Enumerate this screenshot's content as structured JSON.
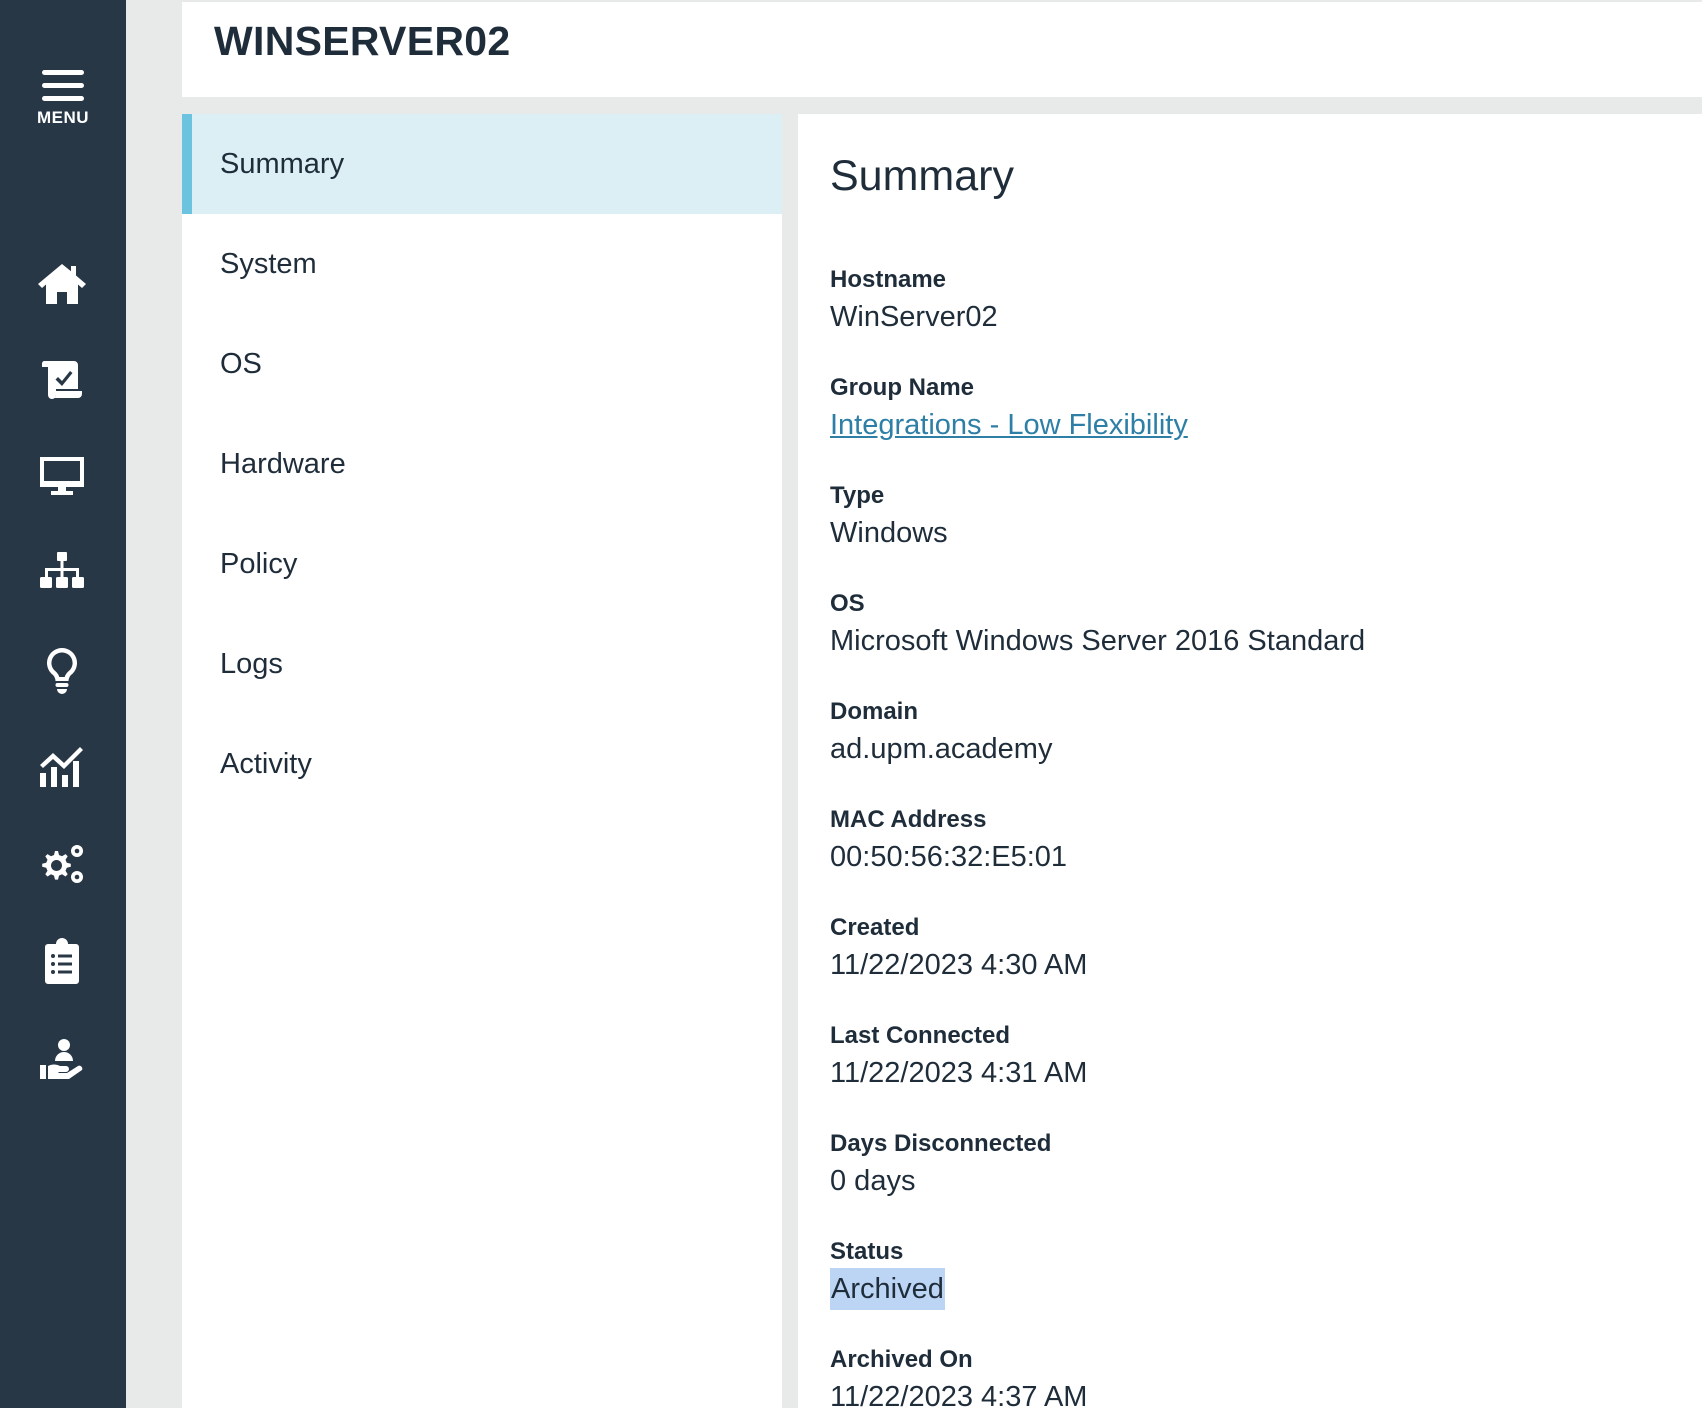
{
  "nav": {
    "menu_label": "MENU",
    "icons": [
      "home-icon",
      "scroll-check-icon",
      "monitor-icon",
      "sitemap-icon",
      "lightbulb-icon",
      "chart-icon",
      "gears-icon",
      "clipboard-list-icon",
      "hand-user-icon"
    ]
  },
  "header": {
    "title": "WINSERVER02"
  },
  "tabs": [
    {
      "label": "Summary",
      "active": true
    },
    {
      "label": "System"
    },
    {
      "label": "OS"
    },
    {
      "label": "Hardware"
    },
    {
      "label": "Policy"
    },
    {
      "label": "Logs"
    },
    {
      "label": "Activity"
    }
  ],
  "summary": {
    "title": "Summary",
    "fields": [
      {
        "label": "Hostname",
        "value": "WinServer02"
      },
      {
        "label": "Group Name",
        "value": "Integrations - Low Flexibility"
      },
      {
        "label": "Type",
        "value": "Windows"
      },
      {
        "label": "OS",
        "value": "Microsoft Windows Server 2016 Standard"
      },
      {
        "label": "Domain",
        "value": "ad.upm.academy"
      },
      {
        "label": "MAC Address",
        "value": "00:50:56:32:E5:01"
      },
      {
        "label": "Created",
        "value": "11/22/2023 4:30 AM"
      },
      {
        "label": "Last Connected",
        "value": "11/22/2023 4:31 AM"
      },
      {
        "label": "Days Disconnected",
        "value": "0 days"
      },
      {
        "label": "Status",
        "value": "Archived"
      },
      {
        "label": "Archived On",
        "value": "11/22/2023 4:37 AM"
      }
    ]
  },
  "colors": {
    "rail": "#283746",
    "active_tab_bg": "#dbeff4",
    "active_tab_accent": "#6cc3e0",
    "link": "#2d7fa6",
    "selection": "#bcd5f5"
  }
}
